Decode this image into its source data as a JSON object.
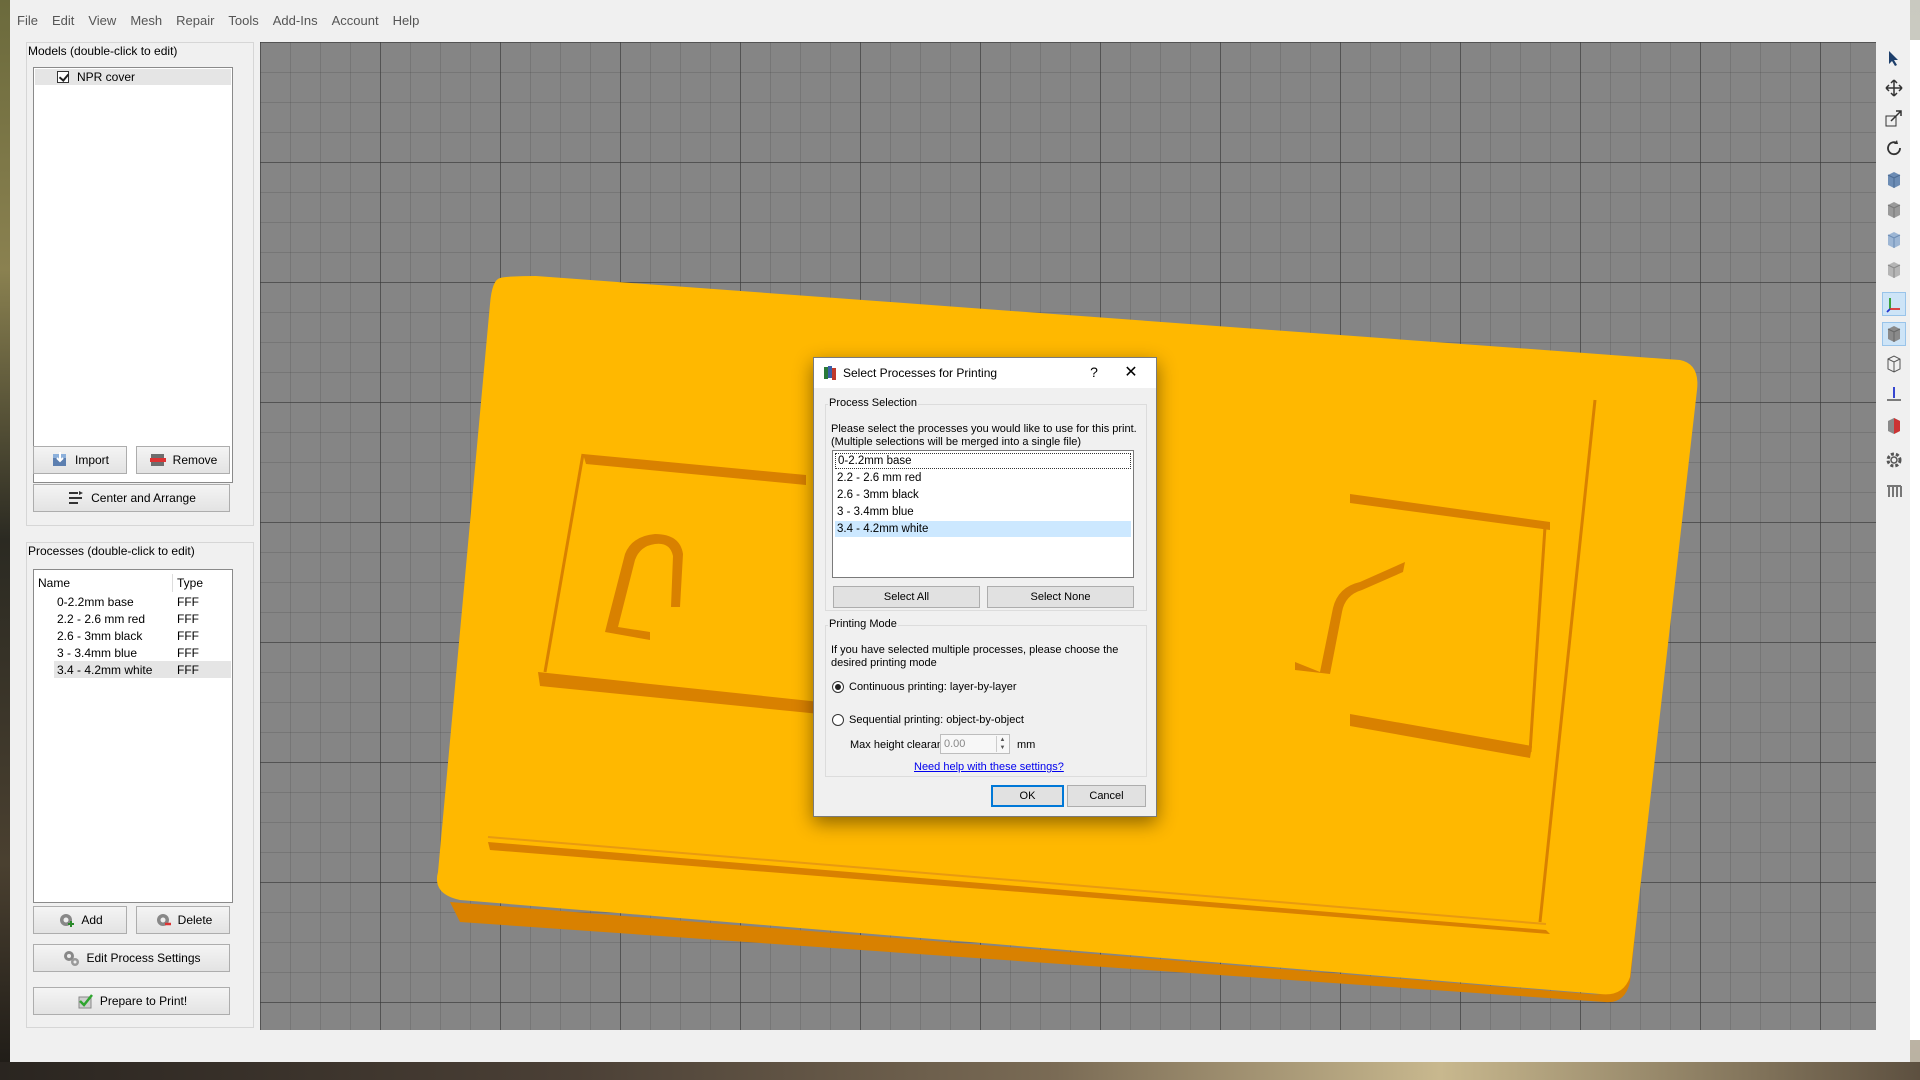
{
  "menu": [
    "File",
    "Edit",
    "View",
    "Mesh",
    "Repair",
    "Tools",
    "Add-Ins",
    "Account",
    "Help"
  ],
  "models": {
    "title": "Models (double-click to edit)",
    "items": [
      {
        "label": "NPR cover",
        "checked": true
      }
    ],
    "import_label": "Import",
    "remove_label": "Remove",
    "center_label": "Center and Arrange"
  },
  "processes": {
    "title": "Processes (double-click to edit)",
    "col_name": "Name",
    "col_type": "Type",
    "rows": [
      {
        "name": "0-2.2mm base",
        "type": "FFF"
      },
      {
        "name": "2.2 - 2.6 mm red",
        "type": "FFF"
      },
      {
        "name": "2.6 - 3mm black",
        "type": "FFF"
      },
      {
        "name": "3 - 3.4mm blue",
        "type": "FFF"
      },
      {
        "name": "3.4 - 4.2mm white",
        "type": "FFF"
      }
    ],
    "add_label": "Add",
    "delete_label": "Delete",
    "edit_label": "Edit Process Settings",
    "prepare_label": "Prepare to Print!"
  },
  "dialog": {
    "title": "Select Processes for Printing",
    "help": "?",
    "close": "✕",
    "selection_legend": "Process Selection",
    "selection_text_1": "Please select the processes you would like to use for this print.",
    "selection_text_2": "(Multiple selections will be merged into a single file)",
    "list": [
      "0-2.2mm base",
      "2.2 - 2.6 mm red",
      "2.6 - 3mm black",
      "3 - 3.4mm blue",
      "3.4 - 4.2mm white"
    ],
    "select_all": "Select All",
    "select_none": "Select None",
    "mode_legend": "Printing Mode",
    "mode_text_1": "If you have selected multiple processes, please choose the",
    "mode_text_2": "desired printing mode",
    "continuous": "Continuous printing: layer-by-layer",
    "sequential": "Sequential printing: object-by-object",
    "max_height_label": "Max height clearance",
    "max_height_value": "0.00",
    "unit": "mm",
    "help_link": "Need help with these settings?",
    "ok": "OK",
    "cancel": "Cancel"
  },
  "colors": {
    "model_top": "#ffb800",
    "model_side": "#d98100",
    "viewport_bg": "#858585",
    "selection": "#cce8ff",
    "accent": "#0078d7"
  }
}
